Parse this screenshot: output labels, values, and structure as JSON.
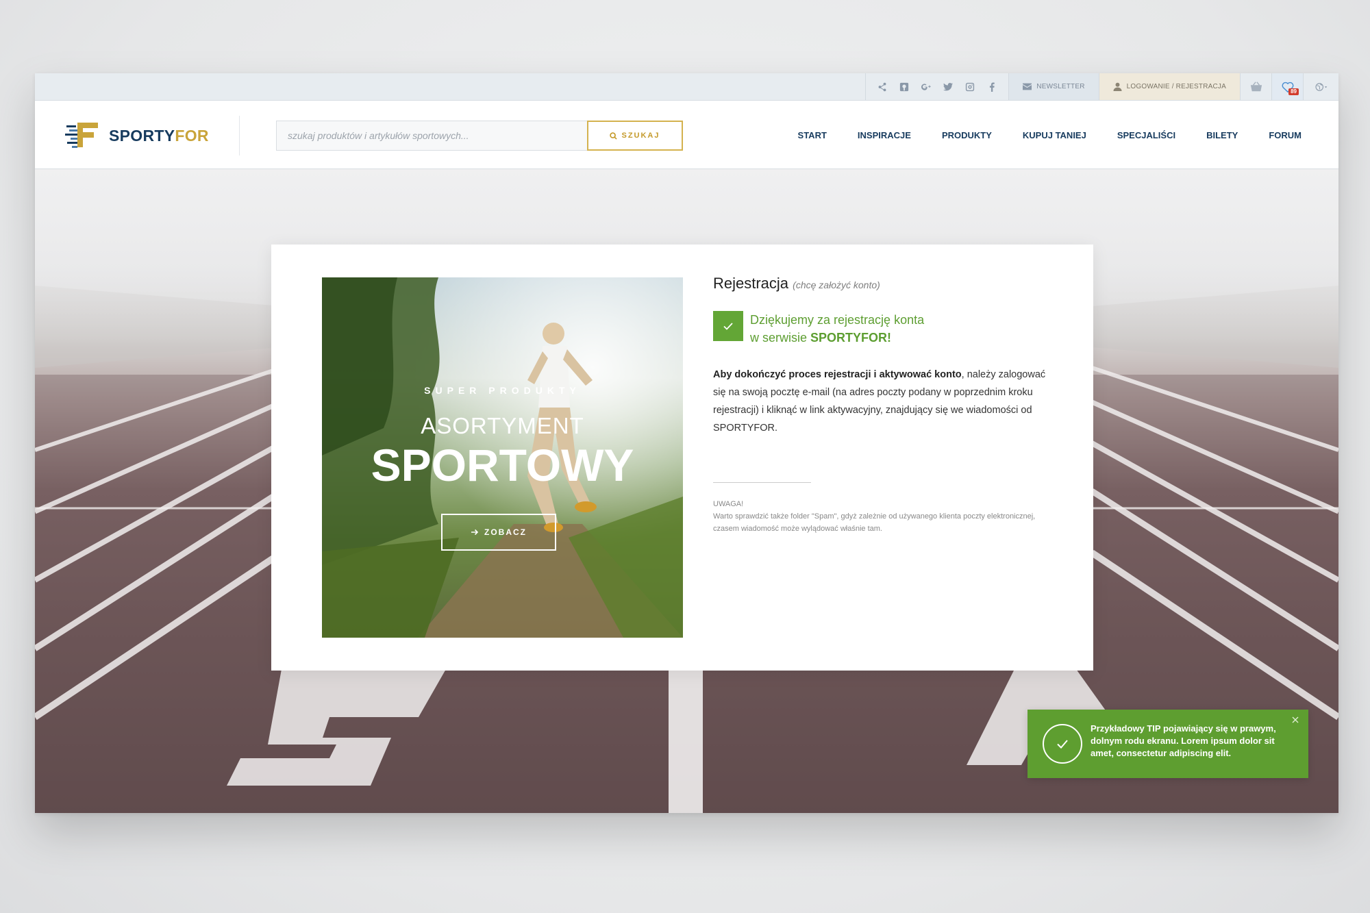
{
  "topbar": {
    "social_icons": [
      "share-icon",
      "pinterest-icon",
      "google-plus-icon",
      "twitter-icon",
      "instagram-icon",
      "facebook-icon"
    ],
    "newsletter_label": "Newsletter",
    "login_label": "Logowanie / Rejestracja",
    "wishlist_count": "89"
  },
  "header": {
    "logo_part1": "SPORTY",
    "logo_part2": "FOR",
    "search_placeholder": "szukaj produktów i artykułów sportowych...",
    "search_button": "Szukaj",
    "nav": [
      "Start",
      "Inspiracje",
      "Produkty",
      "Kupuj taniej",
      "Specjaliści",
      "Bilety",
      "Forum"
    ]
  },
  "promo": {
    "kicker": "Super produkty",
    "title_line1": "Asortyment",
    "title_line2": "Sportowy",
    "button": "Zobacz"
  },
  "registration": {
    "title": "Rejestracja",
    "subtitle": "(chcę założyć konto)",
    "success_line1": "Dziękujemy za rejestrację konta",
    "success_line2_prefix": "w serwisie ",
    "success_line2_brand": "SPORTYFOR!",
    "body_bold": "Aby dokończyć proces rejestracji i aktywować konto",
    "body_rest": ", należy zalogować się na swoją pocztę e-mail (na adres poczty podany w poprzednim kroku rejestracji) i kliknąć w link aktywacyjny, znajdujący się we wiadomości od SPORTYFOR.",
    "note_label": "Uwaga!",
    "note_text": "Warto sprawdzić także folder \"Spam\", gdyż zależnie od używanego klienta poczty elektronicznej, czasem wiadomość może wylądować właśnie tam."
  },
  "toast": {
    "text": "Przykładowy TIP pojawiający się w prawym, dolnym rodu ekranu. Lorem ipsum dolor sit amet, consectetur adipiscing elit."
  },
  "colors": {
    "brand_navy": "#173b5e",
    "brand_gold": "#c9a43a",
    "success_green": "#63a636"
  }
}
